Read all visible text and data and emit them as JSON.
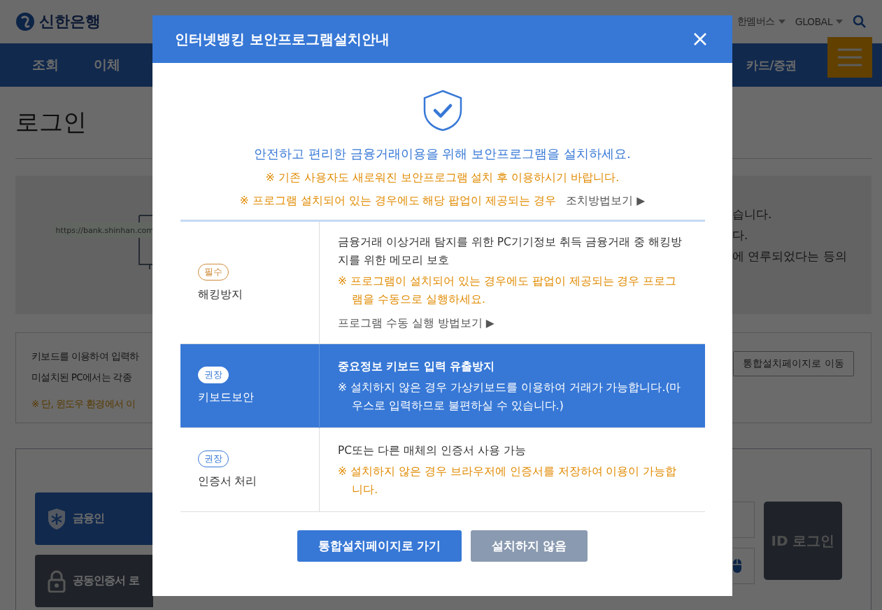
{
  "header": {
    "logo_text": "신한은행",
    "menu_items": [
      {
        "label": "한멤버스"
      },
      {
        "label": "GLOBAL"
      }
    ]
  },
  "nav": {
    "left_items": [
      "조회",
      "이체"
    ],
    "right_items": [
      "카드/증권"
    ]
  },
  "page_title": "로그인",
  "banner": {
    "url_text": "https://bank.shinhan.com",
    "lines": [
      "습니다.",
      "다.",
      "에 연루되었다는 등의"
    ]
  },
  "notice": {
    "lines": [
      {
        "kind": "text",
        "text": "키보드를 이용하여 입력하"
      },
      {
        "kind": "text",
        "text": "미설치된 PC에서는 각종"
      },
      {
        "kind": "warning",
        "text": "※ 단, 윈도우 환경에서 이"
      }
    ],
    "button": "통합설치페이지로 이동"
  },
  "login": {
    "buttons": [
      {
        "label": "금융인",
        "kind": "primary"
      },
      {
        "label": "공동인증서 로",
        "kind": "dark"
      }
    ],
    "id_login": "ID 로그인"
  },
  "modal": {
    "title": "인터넷뱅킹 보안프로그램설치안내",
    "intro": "안전하고 편리한 금융거래이용을 위해 보안프로그램을 설치하세요.",
    "notices": [
      {
        "text": "※ 기존 사용자도 새로워진 보안프로그램 설치 후 이용하시기 바랍니다."
      },
      {
        "text": "※ 프로그램 설치되어 있는 경우에도 해당 팝업이 제공되는 경우",
        "link": "조치방법보기 ▶"
      }
    ],
    "rows": [
      {
        "badge": "필수",
        "kind": "required",
        "name": "해킹방지",
        "selected": false,
        "lines": [
          {
            "kind": "text",
            "text": "금융거래 이상거래 탐지를 위한 PC기기정보 취득 금융거래 중 해킹방지를 위한 메모리 보호"
          },
          {
            "kind": "note",
            "text": "※ 프로그램이 설치되어 있는 경우에도 팝업이 제공되는 경우 프로그램을 수동으로 실행하세요."
          },
          {
            "kind": "link",
            "text": "프로그램 수동 실행 방법보기 ▶"
          }
        ]
      },
      {
        "badge": "권장",
        "kind": "recommended",
        "name": "키보드보안",
        "selected": true,
        "lines": [
          {
            "kind": "title",
            "text": "중요정보 키보드 입력 유출방지"
          },
          {
            "kind": "note",
            "text": "※ 설치하지 않은 경우 가상키보드를 이용하여 거래가 가능합니다.(마우스로 입력하므로 불편하실 수 있습니다.)"
          }
        ]
      },
      {
        "badge": "권장",
        "kind": "recommended",
        "name": "인증서 처리",
        "selected": false,
        "lines": [
          {
            "kind": "text",
            "text": "PC또는 다른 매체의 인증서 사용 가능"
          },
          {
            "kind": "note",
            "text": "※ 설치하지 않은 경우 브라우저에 인증서를 저장하여 이용이 가능합니다."
          }
        ]
      }
    ],
    "buttons": [
      {
        "label": "통합설치페이지로 가기",
        "kind": "primary"
      },
      {
        "label": "설치하지 않음",
        "kind": "secondary"
      }
    ]
  }
}
